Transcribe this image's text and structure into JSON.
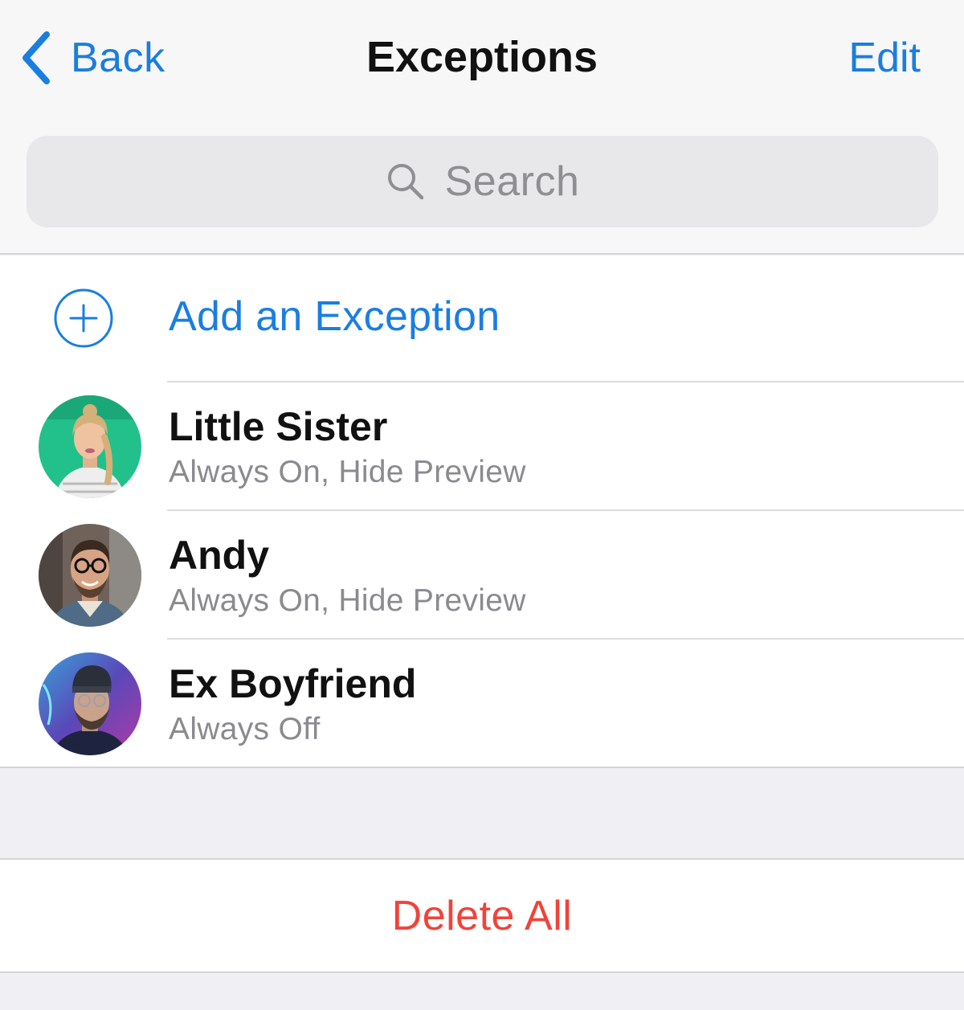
{
  "nav": {
    "back_label": "Back",
    "title": "Exceptions",
    "edit_label": "Edit"
  },
  "search": {
    "placeholder": "Search",
    "icon": "search-icon"
  },
  "add_exception": {
    "label": "Add an Exception",
    "icon": "plus-circle-icon"
  },
  "contacts": [
    {
      "name": "Little Sister",
      "status": "Always On, Hide Preview",
      "avatar": "photo"
    },
    {
      "name": "Andy",
      "status": "Always On, Hide Preview",
      "avatar": "photo"
    },
    {
      "name": "Ex Boyfriend",
      "status": "Always Off",
      "avatar": "photo"
    }
  ],
  "delete_all_label": "Delete All",
  "colors": {
    "accent": "#1a7ee0",
    "destructive": "#f0433a",
    "secondary_text": "#8a8a8f",
    "background": "#efeff4",
    "header_background": "#f7f7f7"
  }
}
